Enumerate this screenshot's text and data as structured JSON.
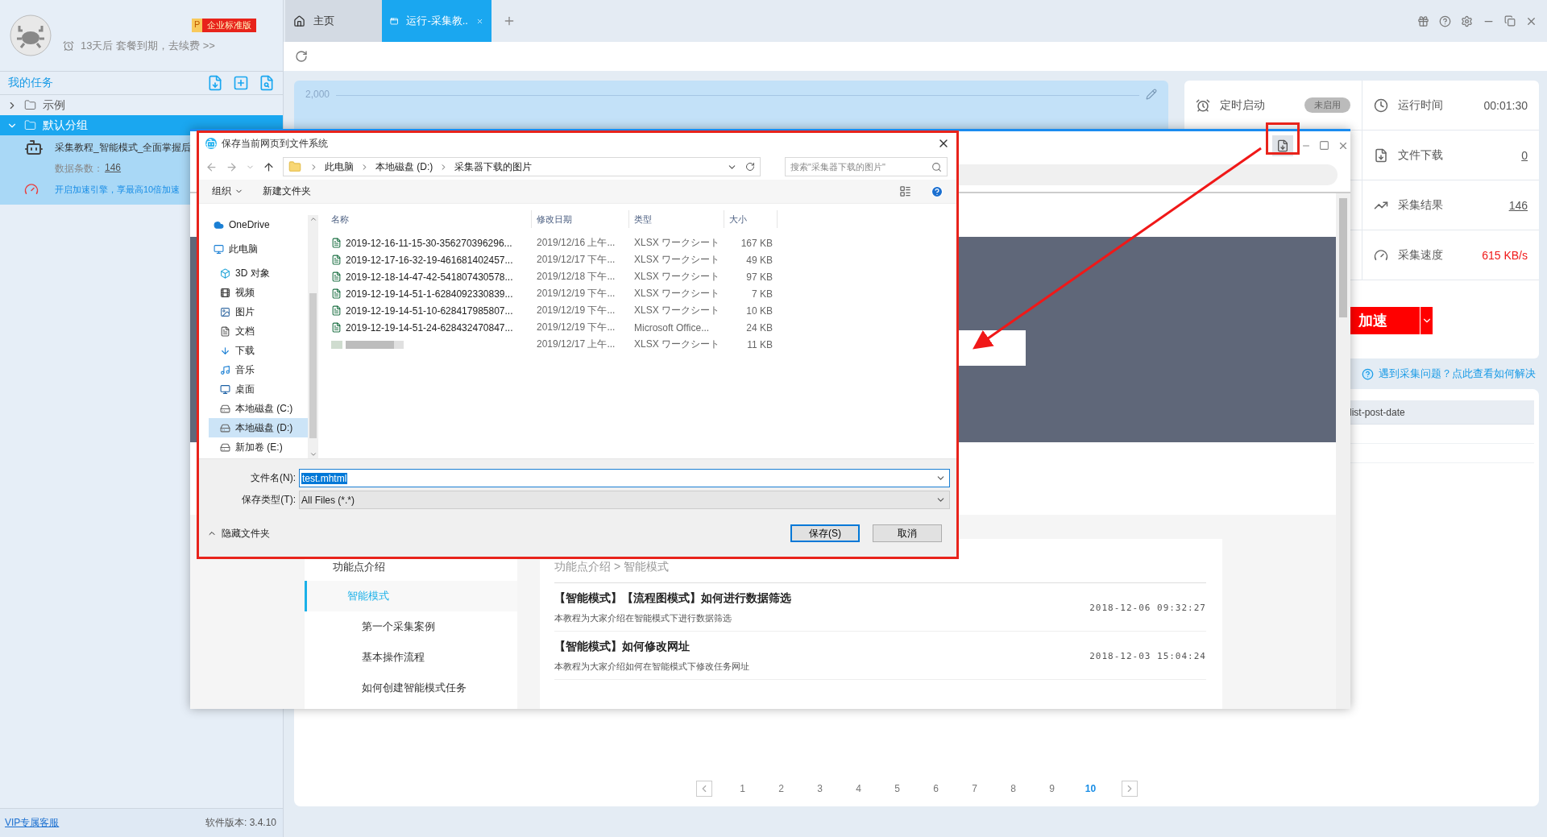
{
  "sidebar": {
    "badge_letter": "P",
    "edition": "企业标准版",
    "expiry": "13天后 套餐到期，去续费 >>",
    "section_title": "我的任务",
    "tree": [
      {
        "label": "示例",
        "expanded": false,
        "selected": false
      },
      {
        "label": "默认分组",
        "expanded": true,
        "selected": true,
        "children": [
          {
            "title": "采集教程_智能模式_全面掌握后",
            "count_label": "数据条数：",
            "count": "146",
            "promo": "开启加速引擎，享最高10倍加速"
          }
        ]
      }
    ],
    "footer": {
      "support_link": "VIP专属客服",
      "version": "软件版本: 3.4.10"
    }
  },
  "tabs": [
    {
      "kind": "home",
      "label": "主页",
      "selected": false
    },
    {
      "kind": "page",
      "label": "运行-采集教..",
      "selected": true
    }
  ],
  "chart": {
    "tick_label": "2,000"
  },
  "schedule": {
    "label": "定时启动",
    "state_label": "未启用",
    "on": false
  },
  "stats": [
    {
      "kind": "time",
      "label": "运行时间",
      "value": "00:01:30"
    },
    {
      "kind": "download",
      "label": "文件下载",
      "value": "0"
    },
    {
      "kind": "result",
      "label": "采集结果",
      "value": "146"
    },
    {
      "kind": "speed",
      "label": "采集速度",
      "value": "615 KB/s"
    }
  ],
  "accelerate_button": "加速",
  "help_link": "遇到采集问题？点此查看如何解决",
  "data_table": {
    "columns": [
      "list-post-date"
    ]
  },
  "pagination": [
    {
      "label": "1",
      "selected": false
    },
    {
      "label": "2",
      "selected": false
    },
    {
      "label": "3",
      "selected": false
    },
    {
      "label": "4",
      "selected": false
    },
    {
      "label": "5",
      "selected": false
    },
    {
      "label": "6",
      "selected": false
    },
    {
      "label": "7",
      "selected": false
    },
    {
      "label": "8",
      "selected": false
    },
    {
      "label": "9",
      "selected": false
    },
    {
      "label": "10",
      "selected": true
    }
  ],
  "browser_window": {
    "nav": [
      {
        "label": "功能点介绍",
        "selected": false,
        "children": [
          {
            "label": "智能模式",
            "selected": true,
            "children": [
              {
                "label": "第一个采集案例",
                "selected": false
              },
              {
                "label": "基本操作流程",
                "selected": false
              },
              {
                "label": "如何创建智能模式任务",
                "selected": false
              }
            ]
          }
        ]
      }
    ],
    "breadcrumb": "功能点介绍 > 智能模式",
    "articles": [
      {
        "title": "【智能模式】【流程图模式】如何进行数据筛选",
        "summary": "本教程为大家介绍在智能模式下进行数据筛选",
        "date": "2018-12-06 09:32:27"
      },
      {
        "title": "【智能模式】如何修改网址",
        "summary": "本教程为大家介绍如何在智能模式下修改任务网址",
        "date": "2018-12-03 15:04:24"
      }
    ]
  },
  "save_dialog": {
    "title": "保存当前网页到文件系统",
    "path": [
      "此电脑",
      "本地磁盘 (D:)",
      "采集器下载的图片"
    ],
    "search_placeholder": "搜索\"采集器下载的图片\"",
    "toolbar": [
      "组织",
      "新建文件夹"
    ],
    "nav_tree": [
      {
        "kind": "cloud",
        "label": "OneDrive",
        "selected": false
      },
      {
        "kind": "pc",
        "label": "此电脑",
        "selected": false,
        "children": [
          {
            "kind": "cube",
            "label": "3D 对象",
            "selected": false
          },
          {
            "kind": "video",
            "label": "视频",
            "selected": false
          },
          {
            "kind": "image",
            "label": "图片",
            "selected": false
          },
          {
            "kind": "doc",
            "label": "文档",
            "selected": false
          },
          {
            "kind": "download",
            "label": "下载",
            "selected": false
          },
          {
            "kind": "music",
            "label": "音乐",
            "selected": false
          },
          {
            "kind": "desktop",
            "label": "桌面",
            "selected": false
          },
          {
            "kind": "drive",
            "label": "本地磁盘 (C:)",
            "selected": false
          },
          {
            "kind": "drive",
            "label": "本地磁盘 (D:)",
            "selected": true
          },
          {
            "kind": "drive",
            "label": "新加卷 (E:)",
            "selected": false
          }
        ]
      }
    ],
    "columns": [
      "名称",
      "修改日期",
      "类型",
      "大小"
    ],
    "files": [
      {
        "blurred": false,
        "name": "2019-12-16-11-15-30-356270396296...",
        "date": "2019/12/16 上午...",
        "type": "XLSX ワークシート",
        "size": "167 KB"
      },
      {
        "blurred": false,
        "name": "2019-12-17-16-32-19-461681402457...",
        "date": "2019/12/17 下午...",
        "type": "XLSX ワークシート",
        "size": "49 KB"
      },
      {
        "blurred": false,
        "name": "2019-12-18-14-47-42-541807430578...",
        "date": "2019/12/18 下午...",
        "type": "XLSX ワークシート",
        "size": "97 KB"
      },
      {
        "blurred": false,
        "name": "2019-12-19-14-51-1-6284092330839...",
        "date": "2019/12/19 下午...",
        "type": "XLSX ワークシート",
        "size": "7 KB"
      },
      {
        "blurred": false,
        "name": "2019-12-19-14-51-10-628417985807...",
        "date": "2019/12/19 下午...",
        "type": "XLSX ワークシート",
        "size": "10 KB"
      },
      {
        "blurred": false,
        "name": "2019-12-19-14-51-24-628432470847...",
        "date": "2019/12/19 下午...",
        "type": "Microsoft Office...",
        "size": "24 KB"
      },
      {
        "blurred": true,
        "date": "2019/12/17 上午...",
        "type": "XLSX ワークシート",
        "size": "11 KB"
      }
    ],
    "file_name_label": "文件名(N):",
    "file_name": "test.mhtml",
    "file_type_label": "保存类型(T):",
    "file_type": "All Files (*.*)",
    "hide_folders": "隐藏文件夹",
    "buttons": [
      {
        "kind": "primary",
        "label": "保存(S)"
      },
      {
        "kind": "normal",
        "label": "取消"
      }
    ]
  }
}
